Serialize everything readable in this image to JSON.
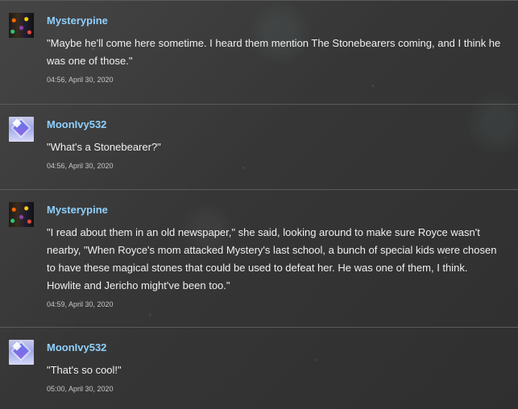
{
  "comments": [
    {
      "username": "Mysterypine",
      "avatar": "mysterypine-avatar",
      "message": "\"Maybe he'll come here sometime. I heard them mention The Stonebearers coming, and I think he was one of those.\"",
      "timestamp": "04:56, April 30, 2020"
    },
    {
      "username": "MoonIvy532",
      "avatar": "moonivy532-avatar",
      "message": "\"What's a Stonebearer?\"",
      "timestamp": "04:56, April 30, 2020"
    },
    {
      "username": "Mysterypine",
      "avatar": "mysterypine-avatar",
      "message": "\"I read about them in an old newspaper,\" she said, looking around to make sure Royce wasn't nearby, \"When Royce's mom attacked Mystery's last school, a bunch of special kids were chosen to have these magical stones that could be used to defeat her. He was one of them, I think. Howlite and Jericho might've been too.\"",
      "timestamp": "04:59, April 30, 2020"
    },
    {
      "username": "MoonIvy532",
      "avatar": "moonivy532-avatar",
      "message": "\"That's so cool!\"",
      "timestamp": "05:00, April 30, 2020"
    }
  ],
  "colors": {
    "background": "#3a3a3a",
    "username": "#8fd0ff",
    "text": "#f0f0f0",
    "timestamp": "#c7c7c7",
    "divider": "#5b5b5b"
  }
}
